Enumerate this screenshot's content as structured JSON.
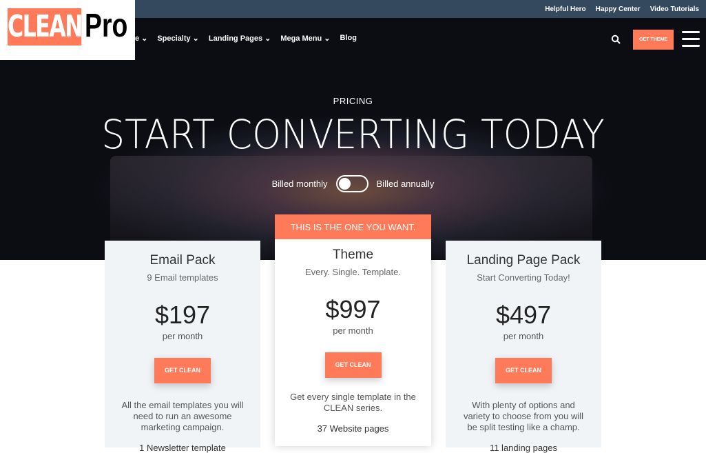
{
  "topbar": {
    "links": [
      "Helpful Hero",
      "Happy Center",
      "Video Tutorials"
    ]
  },
  "logo": {
    "text1": "CLEAN",
    "text2": "Pro",
    "accent": "#ff7a59"
  },
  "nav": {
    "items": [
      "e",
      "Specialty",
      "Landing Pages",
      "Mega Menu",
      "Blog"
    ],
    "get_theme": "GET THEME"
  },
  "hero": {
    "label": "PRICING",
    "title": "START CONVERTING TODAY",
    "billed_monthly": "Billed monthly",
    "billed_annually": "Billed annually",
    "toggle_annual": false
  },
  "plans": [
    {
      "name": "Email Pack",
      "sub": "9 Email templates",
      "price": "$197",
      "per": "per month",
      "button": "GET CLEAN",
      "desc": "All the email templates you will need to run an awesome marketing campaign.",
      "feature": "1 Newsletter template"
    },
    {
      "banner": "THIS IS THE ONE YOU WANT.",
      "name": "Theme",
      "sub": "Every. Single. Template.",
      "price": "$997",
      "per": "per month",
      "button": "GET CLEAN",
      "desc": "Get every single template in the CLEAN series.",
      "feature": "37 Website pages"
    },
    {
      "name": "Landing Page Pack",
      "sub": "Start Converting Today!",
      "price": "$497",
      "per": "per month",
      "button": "GET CLEAN",
      "desc": "With plenty of options and variety to choose from you will be split testing like a champ.",
      "feature": "11 landing pages"
    }
  ]
}
